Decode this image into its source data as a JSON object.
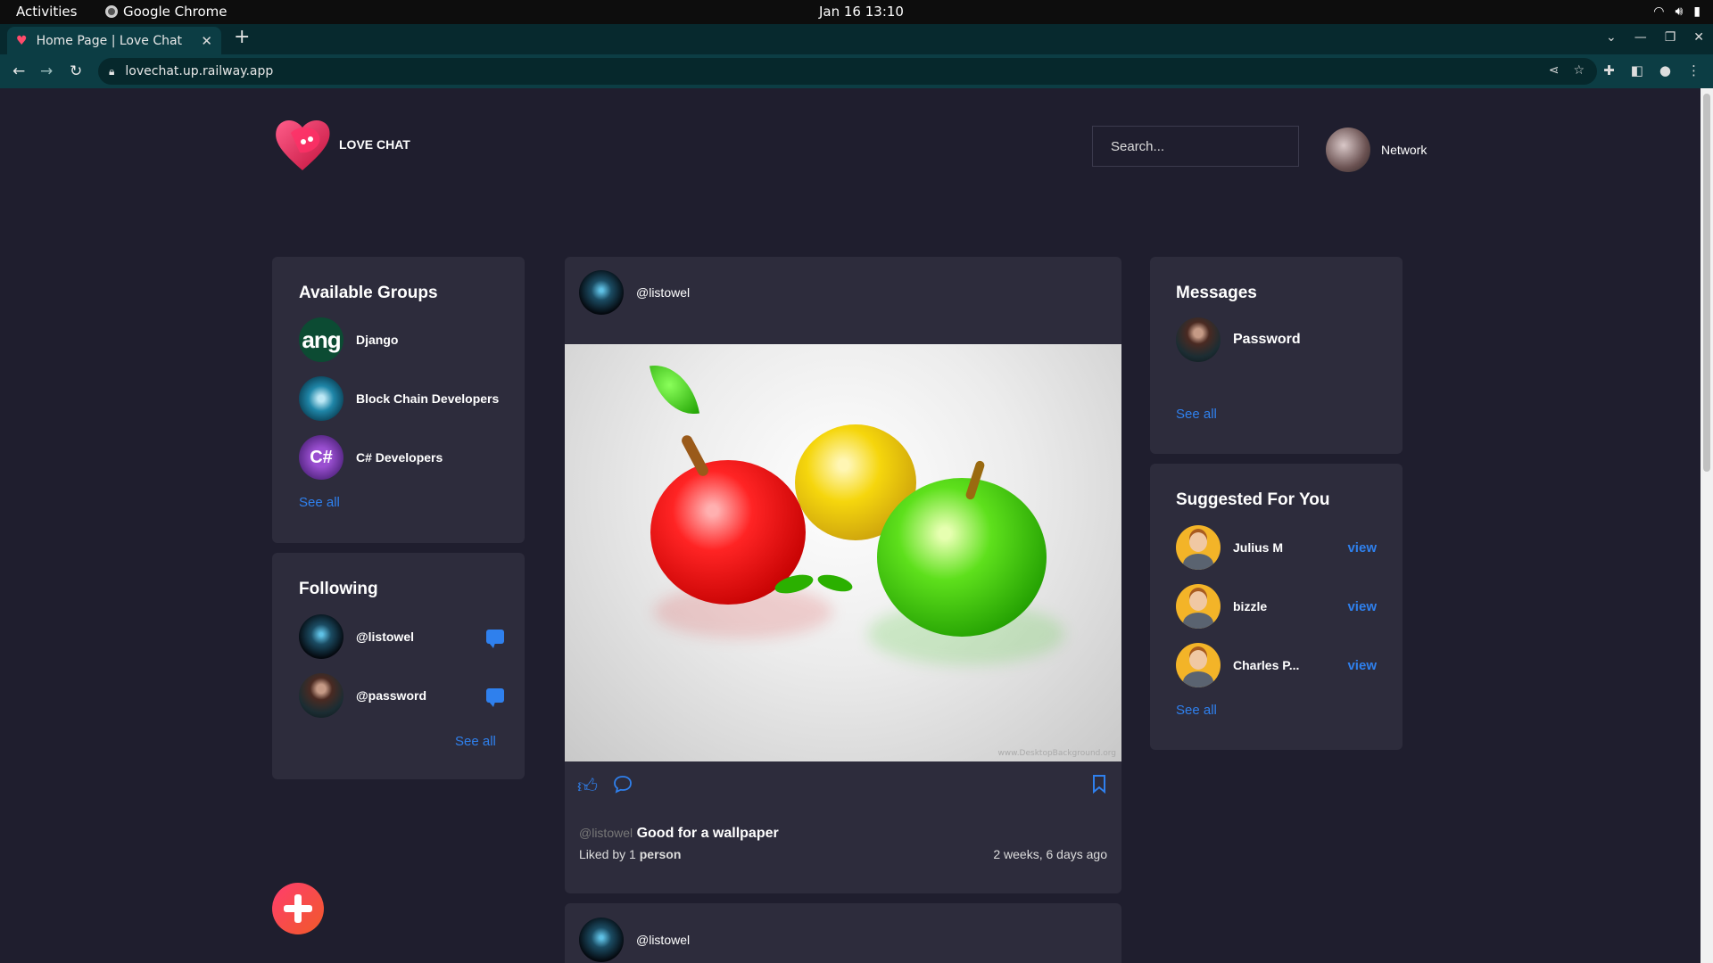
{
  "os": {
    "activities": "Activities",
    "app_name": "Google Chrome",
    "clock": "Jan 16  13:10"
  },
  "browser": {
    "tab_title": "Home Page | Love Chat",
    "url": "lovechat.up.railway.app"
  },
  "header": {
    "logo_text": "LOVE CHAT",
    "search_placeholder": "Search...",
    "profile_label": "Network"
  },
  "groups": {
    "title": "Available Groups",
    "items": [
      {
        "name": "Django",
        "avatar_text": "ang"
      },
      {
        "name": "Block Chain Developers"
      },
      {
        "name": "C# Developers",
        "avatar_text": "C#"
      }
    ],
    "see_all": "See all"
  },
  "following": {
    "title": "Following",
    "items": [
      {
        "name": "@listowel"
      },
      {
        "name": "@password"
      }
    ],
    "see_all": "See all"
  },
  "post": {
    "author": "@listowel",
    "caption_user": "@listowel",
    "caption": "Good for a wallpaper",
    "liked_prefix": "Liked by",
    "liked_count": "1",
    "liked_suffix": "person",
    "time_ago": "2 weeks, 6 days ago",
    "watermark": "www.DesktopBackground.org"
  },
  "post2": {
    "author": "@listowel"
  },
  "messages": {
    "title": "Messages",
    "items": [
      {
        "name": "Password"
      }
    ],
    "see_all": "See all"
  },
  "suggested": {
    "title": "Suggested For You",
    "items": [
      {
        "name": "Julius M",
        "action": "view"
      },
      {
        "name": "bizzle",
        "action": "view"
      },
      {
        "name": "Charles P...",
        "action": "view"
      }
    ],
    "see_all": "See all"
  },
  "colors": {
    "page_bg": "#1f1e2e",
    "card_bg": "#2d2c3c",
    "accent_blue": "#2f80ed",
    "brand_pink": "#ff3d6e"
  }
}
